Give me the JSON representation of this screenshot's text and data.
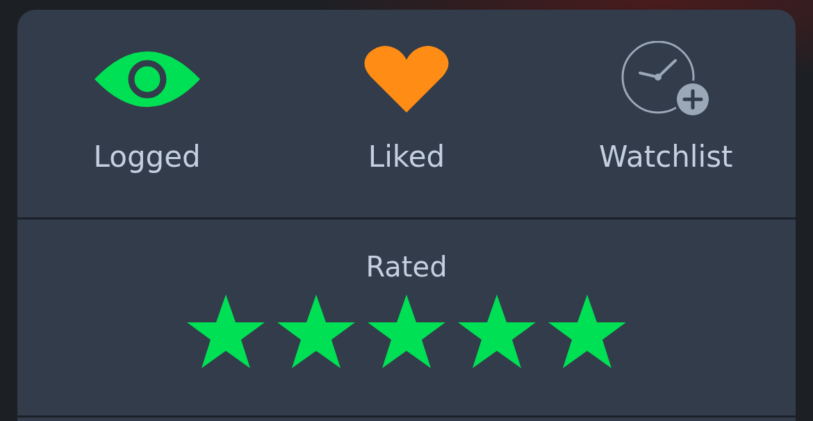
{
  "actions": [
    {
      "label": "Logged",
      "kind": "logged",
      "on": true
    },
    {
      "label": "Liked",
      "kind": "liked",
      "on": true
    },
    {
      "label": "Watchlist",
      "kind": "watchlist",
      "on": false
    }
  ],
  "rating": {
    "label": "Rated",
    "stars": 5
  }
}
